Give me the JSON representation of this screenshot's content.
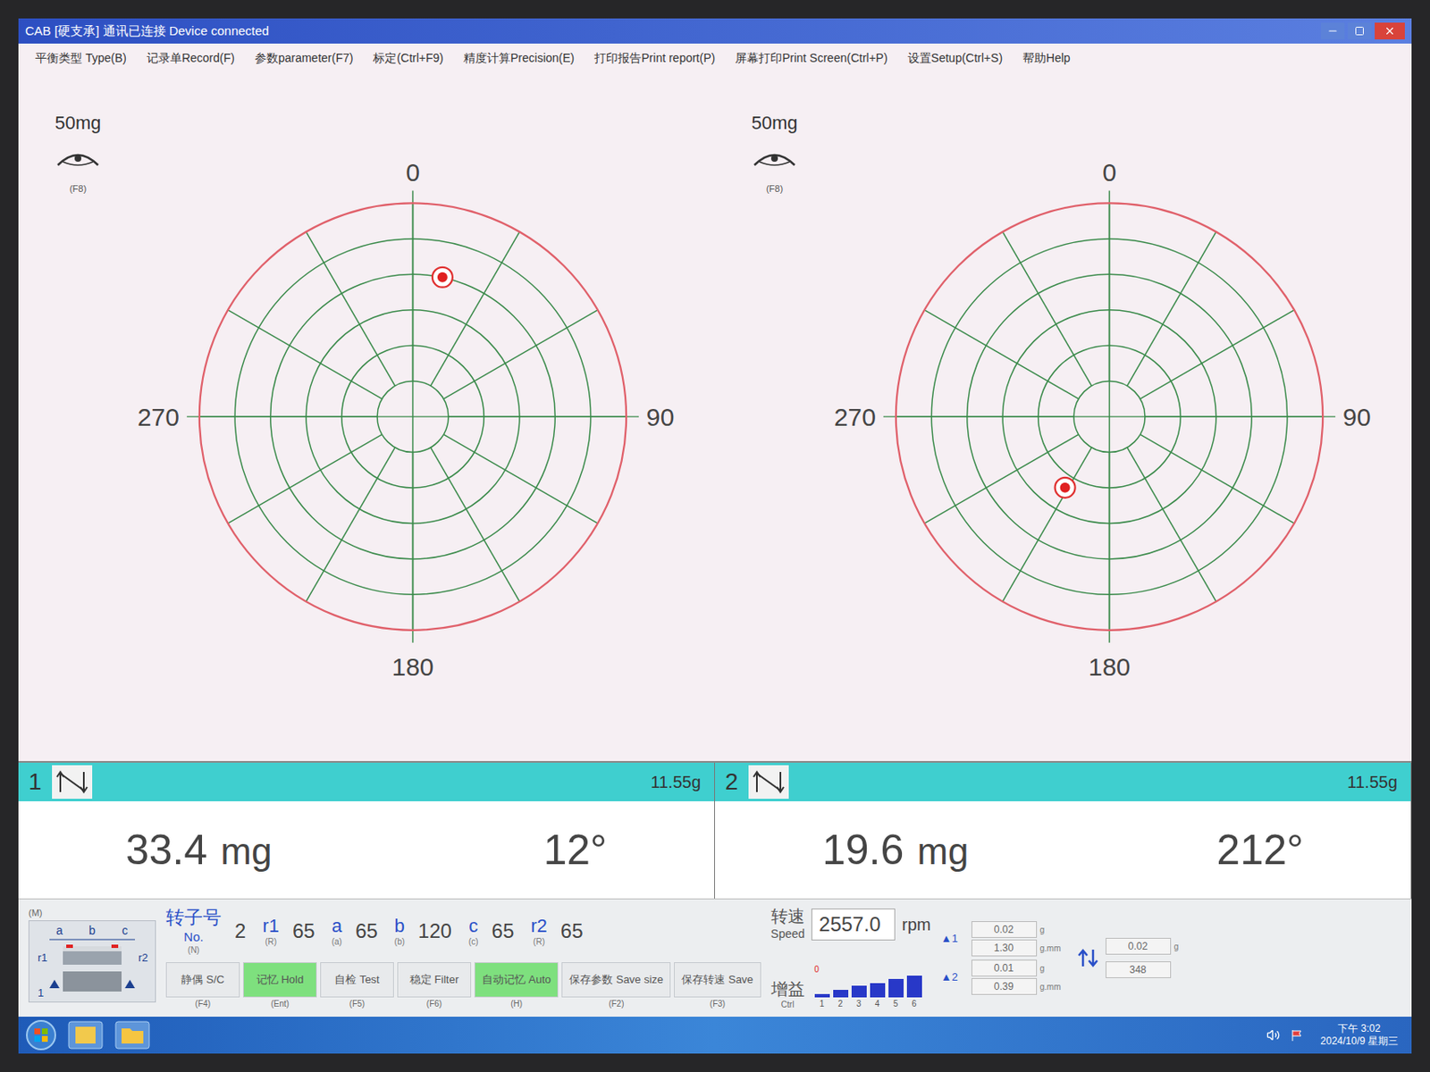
{
  "window": {
    "title": "CAB [硬支承]  通讯已连接 Device connected"
  },
  "menu": [
    "平衡类型 Type(B)",
    "记录单Record(F)",
    "参数parameter(F7)",
    "标定(Ctrl+F9)",
    "精度计算Precision(E)",
    "打印报告Print report(P)",
    "屏幕打印Print Screen(Ctrl+P)",
    "设置Setup(Ctrl+S)",
    "帮助Help"
  ],
  "planes": [
    {
      "id": "1",
      "scale": "50mg",
      "hotkey": "(F8)",
      "scale_max": 50,
      "point": {
        "magnitude": 33.4,
        "angle": 12
      },
      "axis_labels": {
        "top": "0",
        "right": "90",
        "bottom": "180",
        "left": "270"
      },
      "weight": "11.55g",
      "amount": "33.4",
      "unit": "mg",
      "angle": "12°"
    },
    {
      "id": "2",
      "scale": "50mg",
      "hotkey": "(F8)",
      "scale_max": 50,
      "point": {
        "magnitude": 19.6,
        "angle": 212
      },
      "axis_labels": {
        "top": "0",
        "right": "90",
        "bottom": "180",
        "left": "270"
      },
      "weight": "11.55g",
      "amount": "19.6",
      "unit": "mg",
      "angle": "212°"
    }
  ],
  "rotor": {
    "panel_key": "(M)",
    "diagram_labels": {
      "a": "a",
      "b": "b",
      "c": "c",
      "r1": "r1",
      "r2": "r2",
      "plane": "1"
    },
    "fields": [
      {
        "label": "转子号",
        "sub": "No.",
        "key": "(N)",
        "value": "2"
      },
      {
        "label": "r1",
        "sub": "",
        "key": "(R)",
        "value": "65"
      },
      {
        "label": "a",
        "sub": "",
        "key": "(a)",
        "value": "65"
      },
      {
        "label": "b",
        "sub": "",
        "key": "(b)",
        "value": "120"
      },
      {
        "label": "c",
        "sub": "",
        "key": "(c)",
        "value": "65"
      },
      {
        "label": "r2",
        "sub": "",
        "key": "(R)",
        "value": "65"
      }
    ]
  },
  "speed": {
    "label": "转速",
    "sub": "Speed",
    "value": "2557.0",
    "unit": "rpm"
  },
  "buttons": [
    {
      "label": "静偶 S/C",
      "key": "(F4)",
      "selected": false
    },
    {
      "label": "记忆 Hold",
      "key": "(Ent)",
      "selected": true
    },
    {
      "label": "自检 Test",
      "key": "(F5)",
      "selected": false
    },
    {
      "label": "稳定 Filter",
      "key": "(F6)",
      "selected": false
    },
    {
      "label": "自动记忆 Auto",
      "key": "(H)",
      "selected": true
    },
    {
      "label": "保存参数 Save size",
      "key": "(F2)",
      "selected": false
    },
    {
      "label": "保存转速 Save",
      "key": "(F3)",
      "selected": false
    }
  ],
  "gain": {
    "label": "增益",
    "key": "Ctrl",
    "zero": "0",
    "levels": [
      {
        "label": "1",
        "level": 0.15
      },
      {
        "label": "2",
        "level": 0.35
      },
      {
        "label": "3",
        "level": 0.55
      },
      {
        "label": "4",
        "level": 0.65
      },
      {
        "label": "5",
        "level": 0.85
      },
      {
        "label": "6",
        "level": 1.0
      }
    ]
  },
  "tolerances": [
    {
      "marker": "▲1",
      "values": [
        {
          "value": "0.02",
          "unit": "g"
        },
        {
          "value": "1.30",
          "unit": "g.mm"
        }
      ]
    },
    {
      "marker": "▲2",
      "values": [
        {
          "value": "0.01",
          "unit": "g"
        },
        {
          "value": "0.39",
          "unit": "g.mm"
        }
      ]
    }
  ],
  "extra": {
    "values": [
      {
        "value": "0.02",
        "unit": "g"
      },
      {
        "value": "348",
        "unit": ""
      }
    ]
  },
  "taskbar": {
    "time": "下午 3:02",
    "date": "2024/10/9 星期三"
  }
}
